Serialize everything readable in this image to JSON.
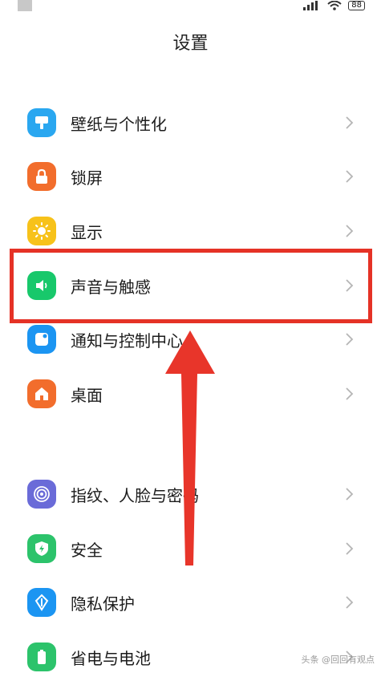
{
  "status_bar": {
    "battery": "88"
  },
  "header": {
    "title": "设置"
  },
  "settings": [
    {
      "label": "壁纸与个性化",
      "icon": "wallpaper-icon",
      "color": "#2aa7f0"
    },
    {
      "label": "锁屏",
      "icon": "lock-icon",
      "color": "#f26d2c"
    },
    {
      "label": "显示",
      "icon": "sun-icon",
      "color": "#f7c21a"
    },
    {
      "label": "声音与触感",
      "icon": "speaker-icon",
      "color": "#18c86b"
    },
    {
      "label": "通知与控制中心",
      "icon": "notification-icon",
      "color": "#1b95f2"
    },
    {
      "label": "桌面",
      "icon": "home-icon",
      "color": "#f26d2c"
    },
    {
      "label": "指纹、人脸与密码",
      "icon": "fingerprint-icon",
      "color": "#6a6bd8"
    },
    {
      "label": "安全",
      "icon": "shield-icon",
      "color": "#2cc36b"
    },
    {
      "label": "隐私保护",
      "icon": "privacy-icon",
      "color": "#1b95f2"
    },
    {
      "label": "省电与电池",
      "icon": "battery-icon",
      "color": "#2cc36b"
    }
  ],
  "annotation": {
    "highlight_color": "#e53226",
    "highlighted_item": "声音与触感"
  },
  "watermark": "头条 @回回有观点"
}
